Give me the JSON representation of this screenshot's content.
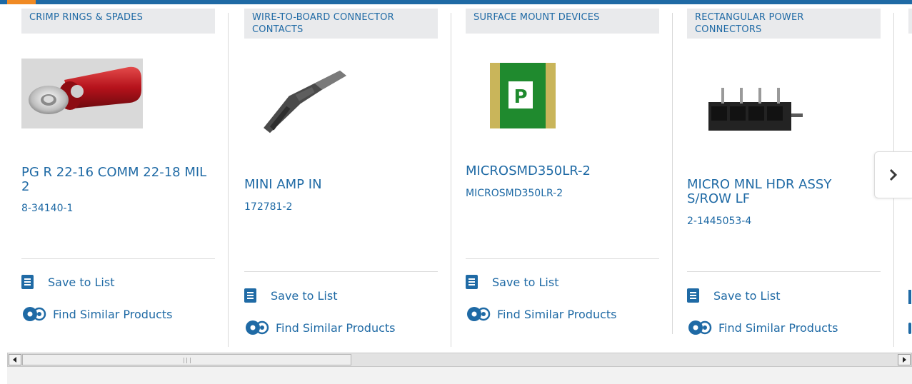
{
  "carousel": {
    "cards": [
      {
        "category": "CRIMP RINGS & SPADES",
        "product_name": "PG R 22-16 COMM 22-18 MIL 2",
        "part_number": "8-34140-1",
        "save_label": "Save to List",
        "similar_label": "Find Similar Products"
      },
      {
        "category": "WIRE-TO-BOARD CONNECTOR CONTACTS",
        "product_name": "MINI AMP IN",
        "part_number": "172781-2",
        "save_label": "Save to List",
        "similar_label": "Find Similar Products"
      },
      {
        "category": "SURFACE MOUNT DEVICES",
        "product_name": "MICROSMD350LR-2",
        "part_number": "MICROSMD350LR-2",
        "save_label": "Save to List",
        "similar_label": "Find Similar Products"
      },
      {
        "category": "RECTANGULAR POWER CONNECTORS",
        "product_name": "MICRO MNL HDR ASSY S/ROW LF",
        "part_number": "2-1445053-4",
        "save_label": "Save to List",
        "similar_label": "Find Similar Products"
      }
    ],
    "smd_letter": "P"
  },
  "colors": {
    "brand_blue": "#1f6aa5",
    "accent_orange": "#f08a24",
    "category_bg": "#e9eaec"
  },
  "icons": {
    "save": "checklist-icon",
    "similar": "gears-icon",
    "next": "chevron-right-icon"
  }
}
